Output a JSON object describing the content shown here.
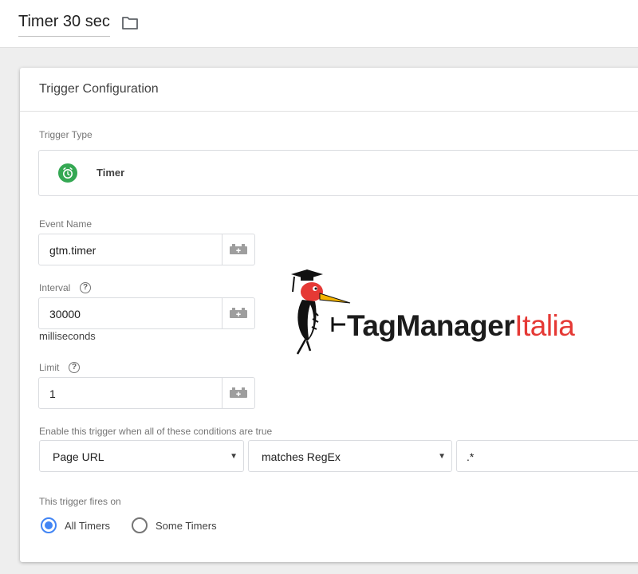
{
  "header": {
    "title": "Timer 30 sec",
    "folder_icon": "folder-icon"
  },
  "card": {
    "title": "Trigger Configuration",
    "trigger_type": {
      "label": "Trigger Type",
      "value": "Timer",
      "icon": "alarm-clock-icon",
      "icon_color": "#34a853"
    },
    "event_name": {
      "label": "Event Name",
      "value": "gtm.timer"
    },
    "interval": {
      "label": "Interval",
      "value": "30000",
      "unit": "milliseconds"
    },
    "limit": {
      "label": "Limit",
      "value": "1"
    },
    "conditions": {
      "label": "Enable this trigger when all of these conditions are true",
      "variable": "Page URL",
      "operator": "matches RegEx",
      "value": ".*"
    },
    "fires_on": {
      "label": "This trigger fires on",
      "options": [
        {
          "label": "All Timers",
          "selected": true
        },
        {
          "label": "Some Timers",
          "selected": false
        }
      ]
    }
  },
  "overlay_logo": {
    "part1": "TagManager",
    "part2": "Italia",
    "colors": {
      "dark": "#1c1c1c",
      "red": "#e53935"
    }
  },
  "colors": {
    "accent": "#4285f4",
    "timer_green": "#34a853"
  }
}
